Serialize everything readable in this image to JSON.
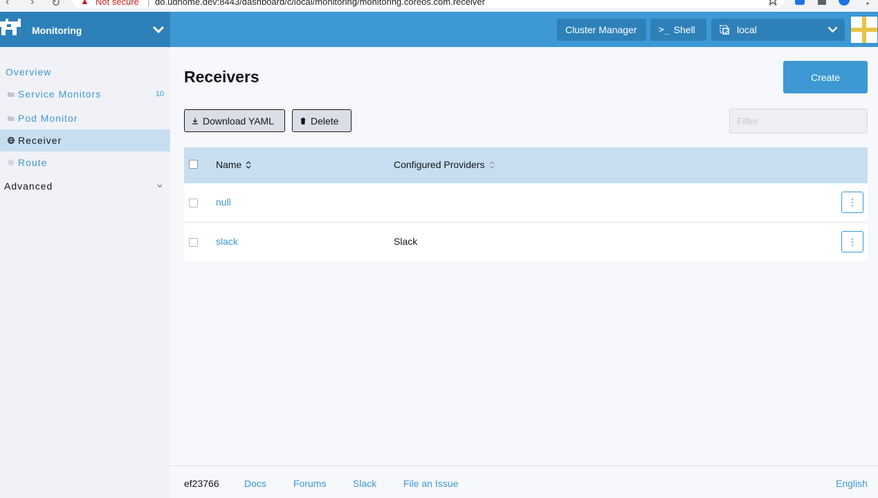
{
  "browser": {
    "security_label": "Not secure",
    "url": "do.udhome.dev:8443/dashboard/c/local/monitoring/monitoring.coreos.com.receiver"
  },
  "header": {
    "product_name": "Monitoring",
    "cluster_manager_label": "Cluster Manager",
    "shell_label": "Shell",
    "namespace_label": "local"
  },
  "sidebar": {
    "overview_label": "Overview",
    "items": [
      {
        "label": "Service Monitors",
        "count": "10"
      },
      {
        "label": "Pod Monitor"
      },
      {
        "label": "Receiver"
      },
      {
        "label": "Route"
      }
    ],
    "advanced_label": "Advanced"
  },
  "main": {
    "title": "Receivers",
    "create_label": "Create",
    "download_label": "Download YAML",
    "delete_label": "Delete",
    "filter_placeholder": "Filter"
  },
  "table": {
    "columns": [
      "Name",
      "Configured Providers"
    ],
    "rows": [
      {
        "name": "null",
        "providers": ""
      },
      {
        "name": "slack",
        "providers": "Slack"
      }
    ]
  },
  "footer": {
    "version": "ef23766",
    "links": [
      "Docs",
      "Forums",
      "Slack",
      "File an Issue"
    ],
    "language": "English"
  },
  "colors": {
    "accent": "#3d98d3",
    "header_dark": "#2e80b9",
    "active_row": "#c7def1",
    "sidebar_bg": "#f1f2f7",
    "page_bg": "#f7f8fb"
  }
}
